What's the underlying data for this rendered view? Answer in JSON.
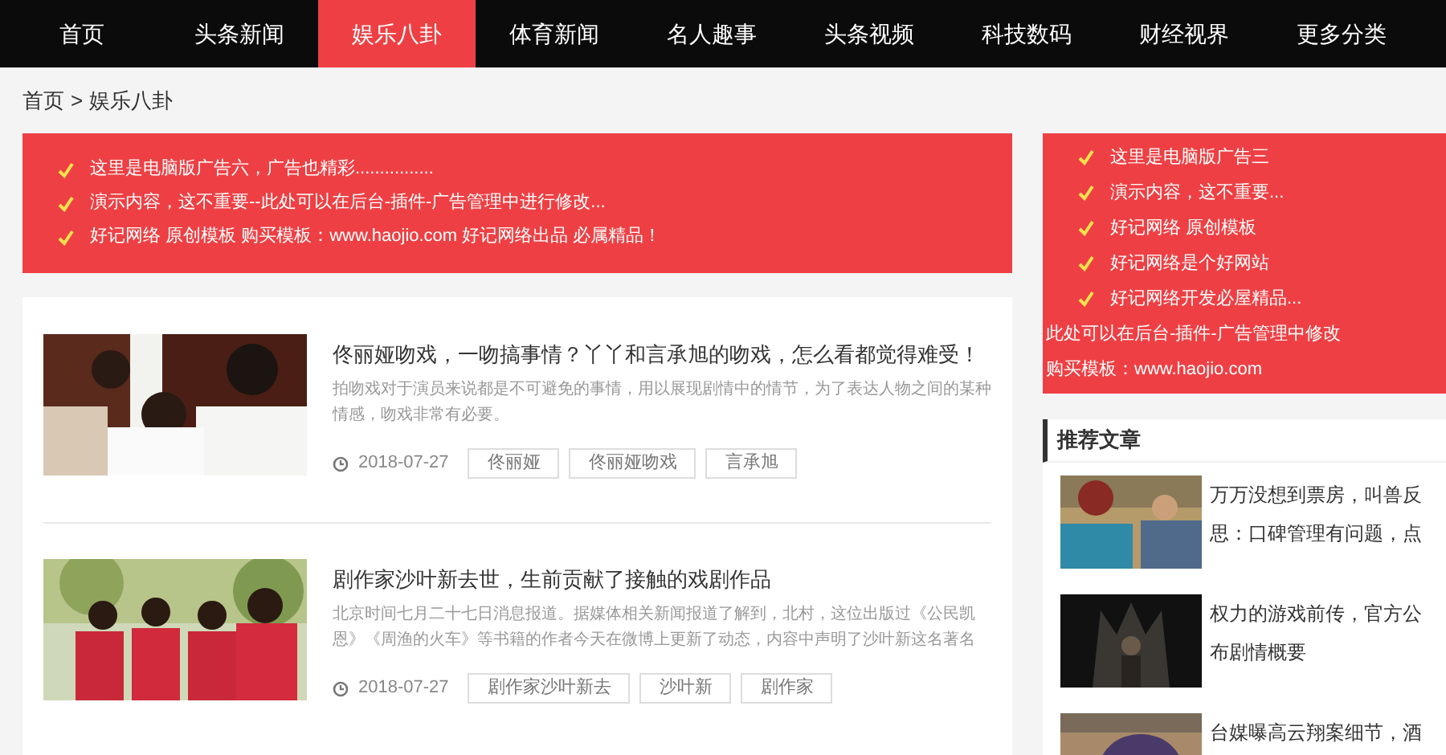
{
  "nav": [
    {
      "label": "首页",
      "selected": false
    },
    {
      "label": "头条新闻",
      "selected": false
    },
    {
      "label": "娱乐八卦",
      "selected": true
    },
    {
      "label": "体育新闻",
      "selected": false
    },
    {
      "label": "名人趣事",
      "selected": false
    },
    {
      "label": "头条视频",
      "selected": false
    },
    {
      "label": "科技数码",
      "selected": false
    },
    {
      "label": "财经视界",
      "selected": false
    },
    {
      "label": "更多分类",
      "selected": false
    }
  ],
  "breadcrumb": {
    "home": "首页",
    "separator": ">",
    "current": "娱乐八卦"
  },
  "main_ad": {
    "lines": [
      {
        "kind": "check",
        "text": "这里是电脑版广告六，广告也精彩................"
      },
      {
        "kind": "check",
        "text": "演示内容，这不重要--此处可以在后台-插件-广告管理中进行修改..."
      },
      {
        "kind": "check",
        "text": "好记网络 原创模板 购买模板：www.haojio.com 好记网络出品 必属精品！"
      }
    ]
  },
  "articles": [
    {
      "title": "佟丽娅吻戏，一吻搞事情？丫丫和言承旭的吻戏，怎么看都觉得难受！",
      "excerpt": "拍吻戏对于演员来说都是不可避免的事情，用以展现剧情中的情节，为了表达人物之间的某种情感，吻戏非常有必要。",
      "date": "2018-07-27",
      "tags": [
        "佟丽娅",
        "佟丽娅吻戏",
        "言承旭"
      ]
    },
    {
      "title": "剧作家沙叶新去世，生前贡献了接触的戏剧作品",
      "excerpt": "北京时间七月二十七日消息报道。据媒体相关新闻报道了解到，北村，这位出版过《公民凯恩》《周渔的火车》等书籍的作者今天在微博上更新了动态，内容中声明了沙叶新这名著名",
      "date": "2018-07-27",
      "tags": [
        "剧作家沙叶新去",
        "沙叶新",
        "剧作家"
      ]
    }
  ],
  "side_ad": {
    "lines": [
      {
        "kind": "check",
        "text": "这里是电脑版广告三"
      },
      {
        "kind": "check",
        "text": "演示内容，这不重要..."
      },
      {
        "kind": "check",
        "text": "好记网络 原创模板"
      },
      {
        "kind": "check",
        "text": "好记网络是个好网站"
      },
      {
        "kind": "check",
        "text": "好记网络开发必屋精品..."
      },
      {
        "kind": "plain",
        "text": "此处可以在后台-插件-广告管理中修改"
      },
      {
        "kind": "plain",
        "text": "购买模板：www.haojio.com"
      }
    ]
  },
  "recommended": {
    "title": "推荐文章",
    "items": [
      {
        "title": "万万没想到票房，叫兽反思：口碑管理有问题，点"
      },
      {
        "title": "权力的游戏前传，官方公布剧情概要"
      },
      {
        "title": "台媒曝高云翔案细节，酒"
      }
    ]
  }
}
